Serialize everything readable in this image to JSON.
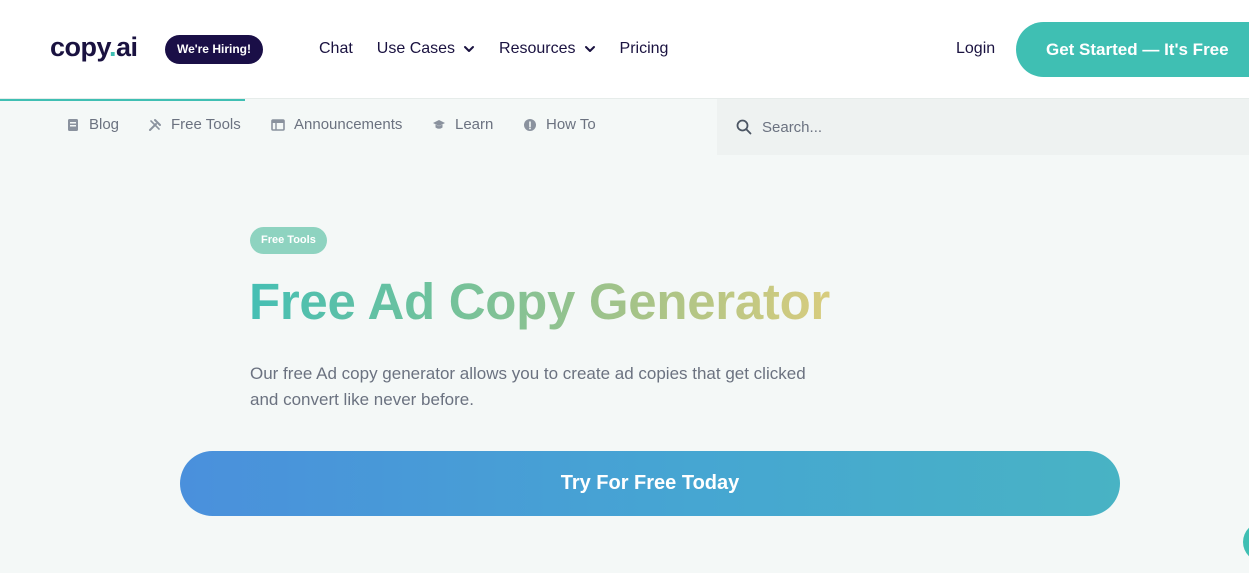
{
  "header": {
    "logo_main": "copy",
    "logo_dot": ".",
    "logo_suffix": "ai",
    "hiring_badge": "We're Hiring!",
    "nav": [
      {
        "label": "Chat"
      },
      {
        "label": "Use Cases"
      },
      {
        "label": "Resources"
      },
      {
        "label": "Pricing"
      }
    ],
    "login": "Login",
    "cta": "Get Started — It's Free"
  },
  "subnav": {
    "items": [
      {
        "label": "Blog",
        "icon": "document-icon"
      },
      {
        "label": "Free Tools",
        "icon": "tools-icon"
      },
      {
        "label": "Announcements",
        "icon": "table-icon"
      },
      {
        "label": "Learn",
        "icon": "graduation-cap-icon"
      },
      {
        "label": "How To",
        "icon": "info-circle-icon"
      }
    ],
    "search_placeholder": "Search..."
  },
  "hero": {
    "badge": "Free Tools",
    "title": "Free Ad Copy Generator",
    "description": "Our free Ad copy generator allows you to create ad copies that get clicked and convert like never before.",
    "cta": "Try For Free Today"
  },
  "colors": {
    "brand_teal": "#3fbfb3",
    "brand_navy": "#1a0f47",
    "cta_gradient_start": "#4a90dc",
    "cta_gradient_end": "#48b3c4"
  }
}
